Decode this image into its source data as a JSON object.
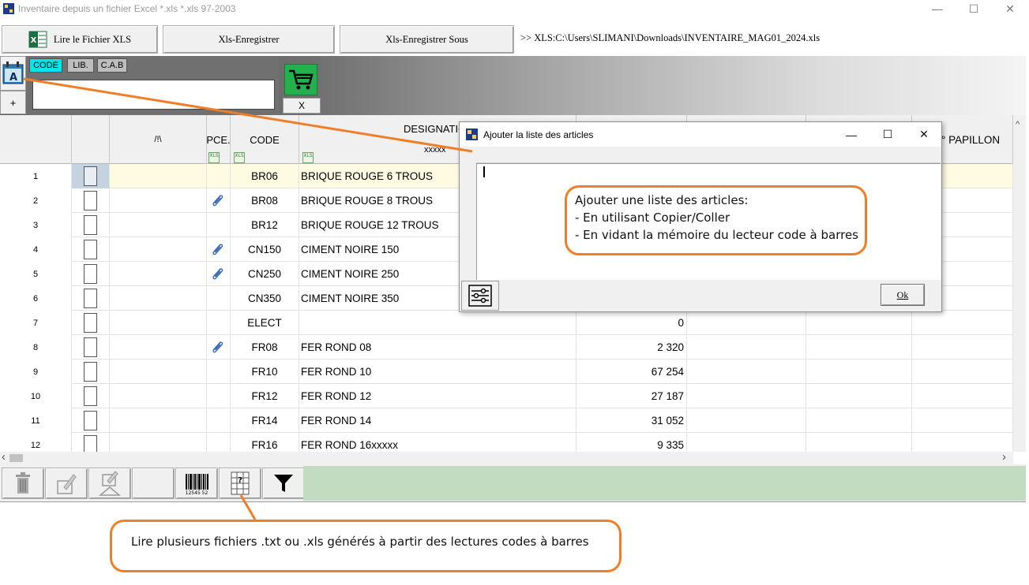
{
  "window": {
    "title": "Inventaire depuis un fichier Excel *.xls *.xls 97-2003",
    "controls": [
      "—",
      "☐",
      "✕"
    ]
  },
  "toolbar": {
    "read_xls": "Lire le Fichier XLS",
    "save_xls": "Xls-Enregistrer",
    "save_as_xls": "Xls-Enregistrer Sous",
    "file_path": ">> XLS:C:\\Users\\SLIMANI\\Downloads\\INVENTAIRE_MAG01_2024.xls"
  },
  "search": {
    "modes": [
      "CODE",
      "LIB.",
      "C.A.B"
    ],
    "active_mode": "CODE",
    "value": "",
    "add_label": "+",
    "cart_clear_label": "X"
  },
  "grid": {
    "headers": {
      "col_sort": "/!\\",
      "col_pce": "PCE.",
      "col_code": "CODE",
      "col_designation": "DESIGNATION",
      "col_designation_sub": "xxxxx",
      "col_papillon": "° PAPILLON"
    },
    "header_badge": "XLS",
    "rows": [
      {
        "num": "1",
        "code": "BR06",
        "designation": "BRIQUE ROUGE 6 TROUS",
        "qty": "",
        "attachment": false,
        "selected": true
      },
      {
        "num": "2",
        "code": "BR08",
        "designation": "BRIQUE ROUGE 8 TROUS",
        "qty": "",
        "attachment": true,
        "selected": false
      },
      {
        "num": "3",
        "code": "BR12",
        "designation": "BRIQUE ROUGE 12 TROUS",
        "qty": "",
        "attachment": false,
        "selected": false
      },
      {
        "num": "4",
        "code": "CN150",
        "designation": "CIMENT NOIRE 150",
        "qty": "",
        "attachment": true,
        "selected": false
      },
      {
        "num": "5",
        "code": "CN250",
        "designation": "CIMENT NOIRE 250",
        "qty": "",
        "attachment": true,
        "selected": false
      },
      {
        "num": "6",
        "code": "CN350",
        "designation": "CIMENT NOIRE 350",
        "qty": "",
        "attachment": false,
        "selected": false
      },
      {
        "num": "7",
        "code": "ELECT",
        "designation": "",
        "qty": "0",
        "attachment": false,
        "selected": false
      },
      {
        "num": "8",
        "code": "FR08",
        "designation": "FER ROND 08",
        "qty": "2 320",
        "attachment": true,
        "selected": false
      },
      {
        "num": "9",
        "code": "FR10",
        "designation": "FER ROND 10",
        "qty": "67 254",
        "attachment": false,
        "selected": false
      },
      {
        "num": "10",
        "code": "FR12",
        "designation": "FER ROND 12",
        "qty": "27 187",
        "attachment": false,
        "selected": false
      },
      {
        "num": "11",
        "code": "FR14",
        "designation": "FER ROND 14",
        "qty": "31 052",
        "attachment": false,
        "selected": false
      },
      {
        "num": "12",
        "code": "FR16",
        "designation": "FER ROND 16xxxxx",
        "qty": "9 335",
        "attachment": false,
        "selected": false
      }
    ]
  },
  "scroll": {
    "left_arrow": "‹",
    "right_arrow": "›",
    "up_arrow": "^"
  },
  "bottombar": {
    "barcode_digits": "12545 52"
  },
  "dialog": {
    "title": "Ajouter la liste des articles",
    "ok_label": "Ok",
    "controls": [
      "—",
      "☐",
      "✕"
    ]
  },
  "callouts": {
    "paste": {
      "line1": "Ajouter une liste des articles:",
      "line2": "- En utilisant Copier/Coller",
      "line3": "- En vidant la mémoire du lecteur code à barres"
    },
    "files": "Lire plusieurs fichiers  .txt ou .xls générés à partir des lectures codes à barres"
  },
  "colors": {
    "accent_orange": "#f07e26",
    "selected_row": "#fffbe2",
    "active_mode": "#00e5ee",
    "cart_green": "#22b14c",
    "green_panel": "#c2dcc2"
  }
}
